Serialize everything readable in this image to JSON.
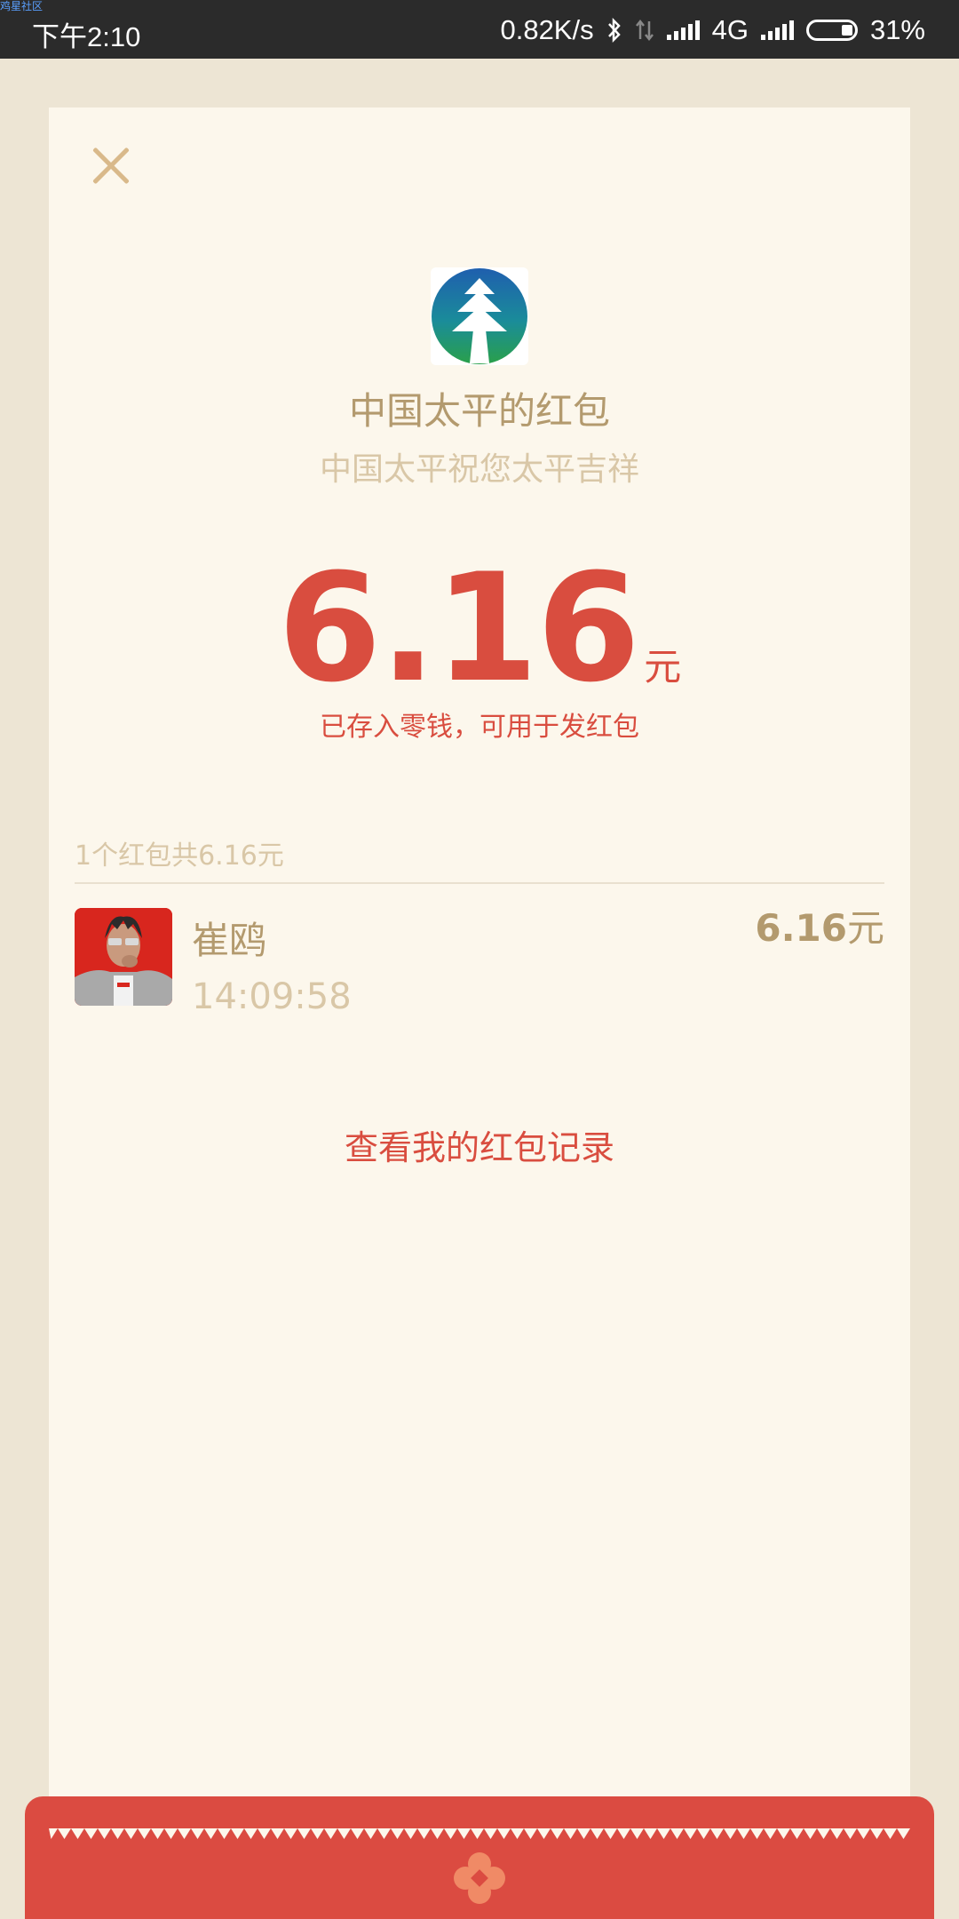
{
  "status_bar": {
    "watermark": "鸡星社区",
    "time": "下午2:10",
    "net_speed": "0.82K/s",
    "network": "4G",
    "battery": "31%"
  },
  "packet": {
    "sender_title": "中国太平的红包",
    "wish": "中国太平祝您太平吉祥",
    "amount": "6.16",
    "amount_unit": "元",
    "saved_note": "已存入零钱，可用于发红包"
  },
  "records": {
    "summary": "1个红包共6.16元",
    "items": [
      {
        "name": "崔鸥",
        "time": "14:09:58",
        "amount": "6.16",
        "unit": "元"
      }
    ]
  },
  "history_link": "查看我的红包记录",
  "colors": {
    "accent_red": "#d94d3f",
    "gold": "#b39a6e",
    "gold_light": "#d9c7a7",
    "card_bg": "#fcf7ec",
    "page_bg": "#ede5d4"
  },
  "icons": {
    "close": "close-icon",
    "logo": "china-taiping-logo",
    "bluetooth": "bluetooth-icon",
    "data_transfer": "data-transfer-icon",
    "signal": "signal-icon",
    "battery": "battery-icon",
    "envelope_emblem": "flower-emblem-icon"
  }
}
